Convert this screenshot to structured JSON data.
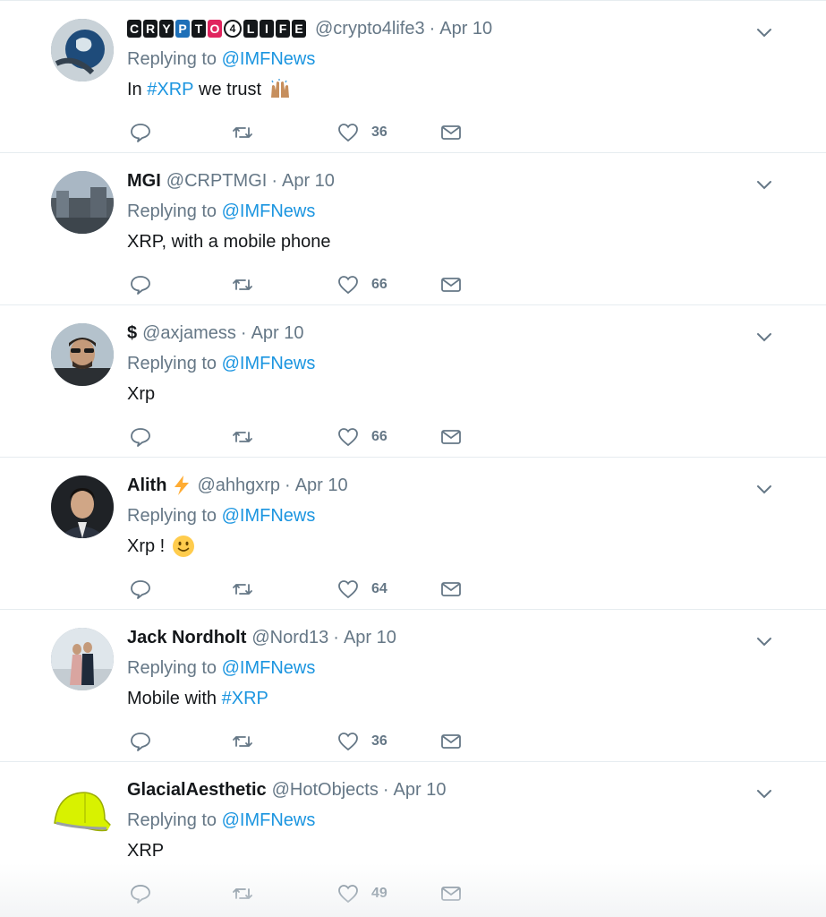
{
  "tweets": [
    {
      "name": "",
      "logo_text": "CRYPTO4LIFE",
      "logo_letters": [
        "C",
        "R",
        "Y",
        "P",
        "T",
        "O",
        "4",
        "L",
        "I",
        "F",
        "E"
      ],
      "handle": "@crypto4life3",
      "date": "Apr 10",
      "replying_label": "Replying to",
      "replying_to": "@IMFNews",
      "text_pre": "In ",
      "hashtag": "#XRP",
      "text_post": " we trust",
      "emoji": "raised-hands-emoji",
      "likes": "36",
      "avatar": "earth-globe-avatar"
    },
    {
      "name": "MGI",
      "handle": "@CRPTMGI",
      "date": "Apr 10",
      "replying_label": "Replying to",
      "replying_to": "@IMFNews",
      "text": "XRP, with a mobile phone",
      "likes": "66",
      "avatar": "city-street-avatar"
    },
    {
      "name": "$",
      "handle": "@axjamess",
      "date": "Apr 10",
      "replying_label": "Replying to",
      "replying_to": "@IMFNews",
      "text": "Xrp",
      "likes": "66",
      "avatar": "man-sunglasses-avatar"
    },
    {
      "name": "Alith",
      "name_emoji": "lightning-bolt-emoji",
      "handle": "@ahhgxrp",
      "date": "Apr 10",
      "replying_label": "Replying to",
      "replying_to": "@IMFNews",
      "text": "Xrp !",
      "emoji": "slightly-smiling-face-emoji",
      "likes": "64",
      "avatar": "man-suit-avatar"
    },
    {
      "name": "Jack Nordholt",
      "handle": "@Nord13",
      "date": "Apr 10",
      "replying_label": "Replying to",
      "replying_to": "@IMFNews",
      "text_pre": "Mobile with ",
      "hashtag": "#XRP",
      "likes": "36",
      "avatar": "couple-avatar"
    },
    {
      "name": "GlacialAesthetic",
      "handle": "@HotObjects",
      "date": "Apr 10",
      "replying_label": "Replying to",
      "replying_to": "@IMFNews",
      "text": "XRP",
      "likes": "49",
      "avatar": "yellow-cap-avatar"
    }
  ],
  "separator": "·",
  "colors": {
    "link": "#1b95e0",
    "muted": "#657786",
    "text": "#14171a",
    "divider": "#e6ecf0"
  }
}
